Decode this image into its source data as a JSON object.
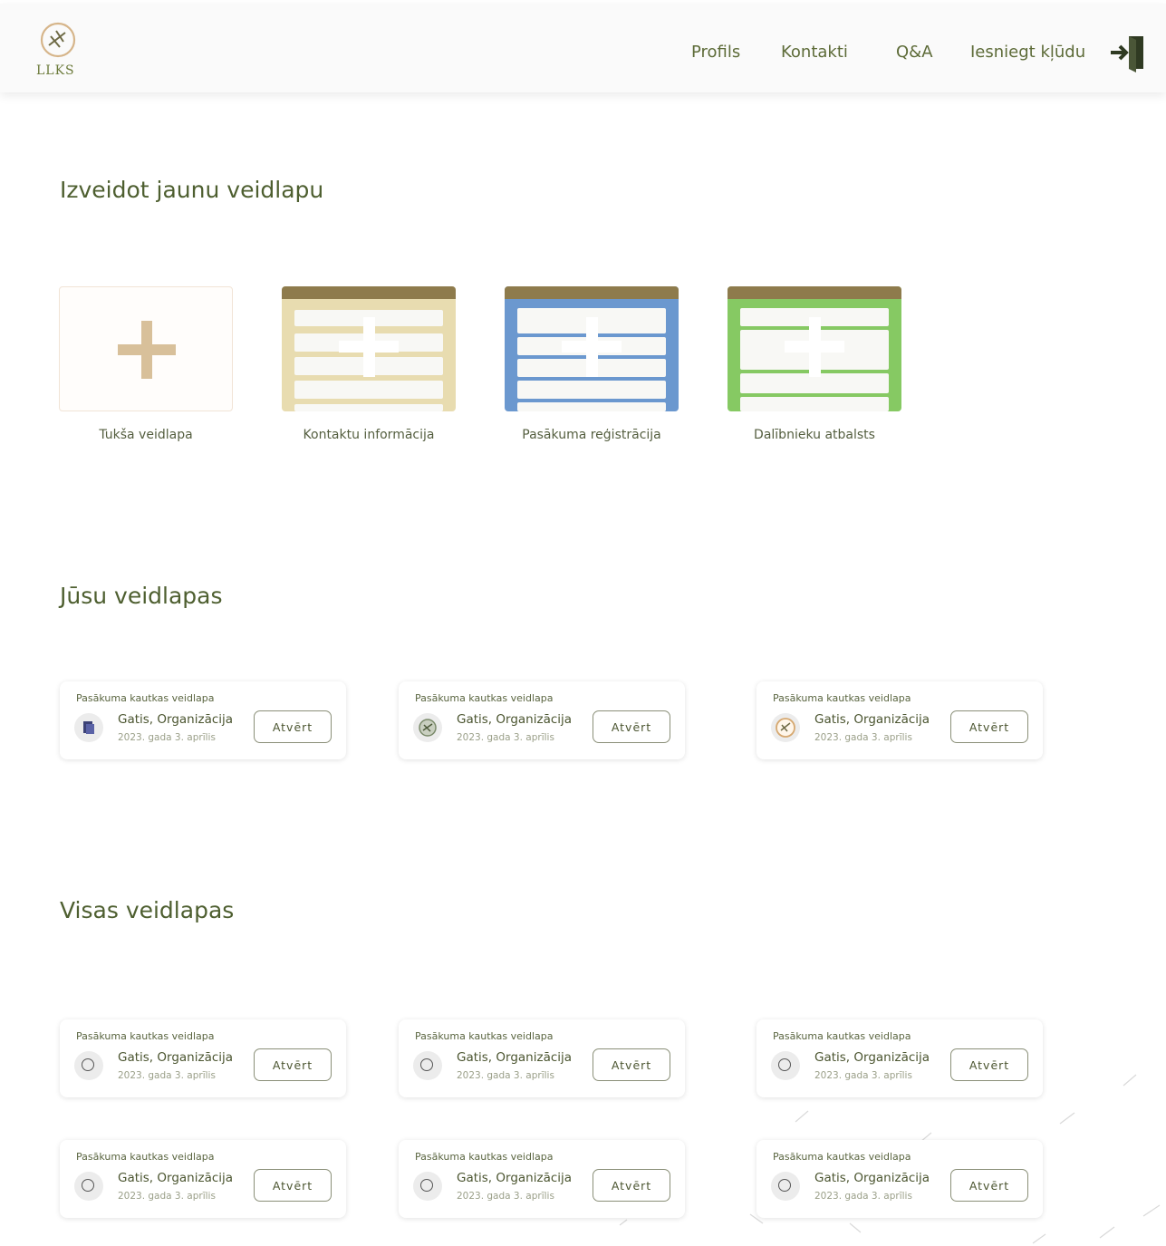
{
  "header": {
    "logo_text": "LLKS",
    "nav": [
      {
        "label": "Profils"
      },
      {
        "label": "Kontakti"
      },
      {
        "label": "Q&A"
      },
      {
        "label": "Iesniegt kļūdu"
      }
    ],
    "logout_icon": "logout-icon"
  },
  "create": {
    "title": "Izveidot jaunu veidlapu",
    "templates": [
      {
        "label": "Tukša veidlapa",
        "color": "#fffdfb"
      },
      {
        "label": "Kontaktu informācija",
        "color": "#e8dcb0"
      },
      {
        "label": "Pasākuma reģistrācija",
        "color": "#6b98cf"
      },
      {
        "label": "Dalībnieku atbalsts",
        "color": "#86c963"
      }
    ]
  },
  "yours": {
    "title": "Jūsu veidlapas",
    "cards": [
      {
        "title": "Pasākuma kautkas veidlapa",
        "author": "Gatis, Organizācija",
        "date": "2023. gada 3. aprīlis",
        "button": "Atvērt",
        "icon": "document-icon"
      },
      {
        "title": "Pasākuma kautkas veidlapa",
        "author": "Gatis, Organizācija",
        "date": "2023. gada 3. aprīlis",
        "button": "Atvērt",
        "icon": "emblem-icon"
      },
      {
        "title": "Pasākuma kautkas veidlapa",
        "author": "Gatis, Organizācija",
        "date": "2023. gada 3. aprīlis",
        "button": "Atvērt",
        "icon": "logo-icon"
      }
    ]
  },
  "all": {
    "title": "Visas veidlapas",
    "cards": [
      {
        "title": "Pasākuma kautkas veidlapa",
        "author": "Gatis, Organizācija",
        "date": "2023. gada 3. aprīlis",
        "button": "Atvērt",
        "icon": "circle-icon"
      },
      {
        "title": "Pasākuma kautkas veidlapa",
        "author": "Gatis, Organizācija",
        "date": "2023. gada 3. aprīlis",
        "button": "Atvērt",
        "icon": "circle-icon"
      },
      {
        "title": "Pasākuma kautkas veidlapa",
        "author": "Gatis, Organizācija",
        "date": "2023. gada 3. aprīlis",
        "button": "Atvērt",
        "icon": "circle-icon"
      },
      {
        "title": "Pasākuma kautkas veidlapa",
        "author": "Gatis, Organizācija",
        "date": "2023. gada 3. aprīlis",
        "button": "Atvērt",
        "icon": "circle-icon"
      },
      {
        "title": "Pasākuma kautkas veidlapa",
        "author": "Gatis, Organizācija",
        "date": "2023. gada 3. aprīlis",
        "button": "Atvērt",
        "icon": "circle-icon"
      },
      {
        "title": "Pasākuma kautkas veidlapa",
        "author": "Gatis, Organizācija",
        "date": "2023. gada 3. aprīlis",
        "button": "Atvērt",
        "icon": "circle-icon"
      }
    ]
  }
}
